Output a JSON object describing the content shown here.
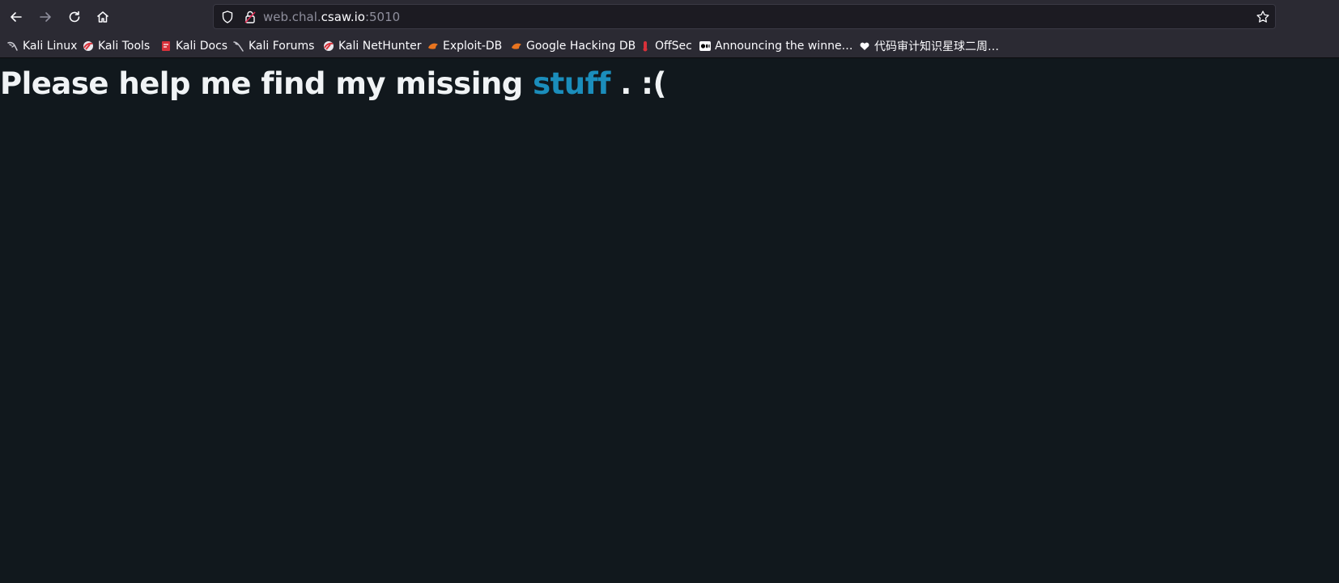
{
  "browser": {
    "url_prefix": "web.chal.",
    "url_host": "csaw.io",
    "url_suffix": ":5010",
    "bookmarks": [
      {
        "label": "Kali Linux",
        "icon": "kali-dragon-icon"
      },
      {
        "label": "Kali Tools",
        "icon": "kali-red-icon"
      },
      {
        "label": "Kali Docs",
        "icon": "kali-docs-icon"
      },
      {
        "label": "Kali Forums",
        "icon": "kali-dragon-icon"
      },
      {
        "label": "Kali NetHunter",
        "icon": "kali-red-icon"
      },
      {
        "label": "Exploit-DB",
        "icon": "exploit-db-icon"
      },
      {
        "label": "Google Hacking DB",
        "icon": "exploit-db-icon"
      },
      {
        "label": "OffSec",
        "icon": "offsec-icon"
      },
      {
        "label": "Announcing the winne…",
        "icon": "medium-icon"
      },
      {
        "label": "代码审计知识星球二周…",
        "icon": "heart-icon"
      }
    ]
  },
  "page": {
    "heading_prefix": "Please help me find my missing ",
    "heading_link": "stuff",
    "heading_suffix": " . :("
  },
  "colors": {
    "page_background": "#11181d",
    "chrome_background": "#2b2a33",
    "link": "#1b8dbb",
    "heading_text": "#f0f3f5"
  }
}
